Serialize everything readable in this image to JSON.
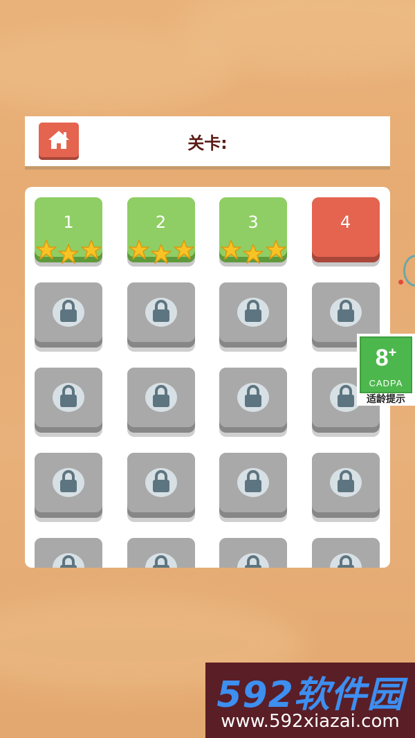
{
  "header": {
    "title": "关卡:",
    "home_icon": "home-icon"
  },
  "levels": [
    {
      "label": "1",
      "state": "done",
      "stars": 3
    },
    {
      "label": "2",
      "state": "done",
      "stars": 3
    },
    {
      "label": "3",
      "state": "done",
      "stars": 3
    },
    {
      "label": "4",
      "state": "current",
      "stars": 0
    },
    {
      "label": "",
      "state": "locked"
    },
    {
      "label": "",
      "state": "locked"
    },
    {
      "label": "",
      "state": "locked"
    },
    {
      "label": "",
      "state": "locked"
    },
    {
      "label": "",
      "state": "locked"
    },
    {
      "label": "",
      "state": "locked"
    },
    {
      "label": "",
      "state": "locked"
    },
    {
      "label": "",
      "state": "locked"
    },
    {
      "label": "",
      "state": "locked"
    },
    {
      "label": "",
      "state": "locked"
    },
    {
      "label": "",
      "state": "locked"
    },
    {
      "label": "",
      "state": "locked"
    },
    {
      "label": "",
      "state": "locked"
    },
    {
      "label": "",
      "state": "locked"
    },
    {
      "label": "",
      "state": "locked"
    },
    {
      "label": "",
      "state": "locked"
    }
  ],
  "age_badge": {
    "age": "8",
    "plus": "+",
    "org": "CADPA",
    "hint": "适龄提示"
  },
  "watermark": {
    "logo": "592软件园",
    "url": "www.592xiazai.com"
  },
  "colors": {
    "done": "#8fce64",
    "current": "#e46450",
    "locked": "#a9a9a9",
    "star": "#f7c325"
  }
}
